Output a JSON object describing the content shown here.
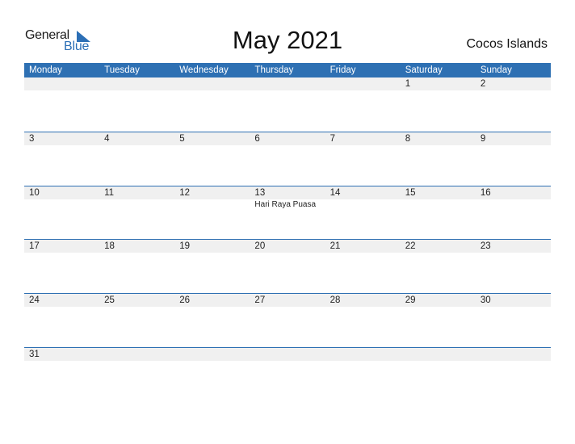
{
  "logo": {
    "general": "General",
    "blue": "Blue",
    "icon": "triangle-flag-icon",
    "color": "#2c6fb6"
  },
  "title": "May 2021",
  "country": "Cocos Islands",
  "accent_color": "#2e70b3",
  "weekdays": [
    "Monday",
    "Tuesday",
    "Wednesday",
    "Thursday",
    "Friday",
    "Saturday",
    "Sunday"
  ],
  "weeks": [
    {
      "days": [
        {
          "n": ""
        },
        {
          "n": ""
        },
        {
          "n": ""
        },
        {
          "n": ""
        },
        {
          "n": ""
        },
        {
          "n": "1"
        },
        {
          "n": "2"
        }
      ]
    },
    {
      "days": [
        {
          "n": "3"
        },
        {
          "n": "4"
        },
        {
          "n": "5"
        },
        {
          "n": "6"
        },
        {
          "n": "7"
        },
        {
          "n": "8"
        },
        {
          "n": "9"
        }
      ]
    },
    {
      "days": [
        {
          "n": "10"
        },
        {
          "n": "11"
        },
        {
          "n": "12"
        },
        {
          "n": "13",
          "holiday": "Hari Raya Puasa"
        },
        {
          "n": "14"
        },
        {
          "n": "15"
        },
        {
          "n": "16"
        }
      ]
    },
    {
      "days": [
        {
          "n": "17"
        },
        {
          "n": "18"
        },
        {
          "n": "19"
        },
        {
          "n": "20"
        },
        {
          "n": "21"
        },
        {
          "n": "22"
        },
        {
          "n": "23"
        }
      ]
    },
    {
      "days": [
        {
          "n": "24"
        },
        {
          "n": "25"
        },
        {
          "n": "26"
        },
        {
          "n": "27"
        },
        {
          "n": "28"
        },
        {
          "n": "29"
        },
        {
          "n": "30"
        }
      ]
    },
    {
      "days": [
        {
          "n": "31"
        },
        {
          "n": ""
        },
        {
          "n": ""
        },
        {
          "n": ""
        },
        {
          "n": ""
        },
        {
          "n": ""
        },
        {
          "n": ""
        }
      ]
    }
  ]
}
